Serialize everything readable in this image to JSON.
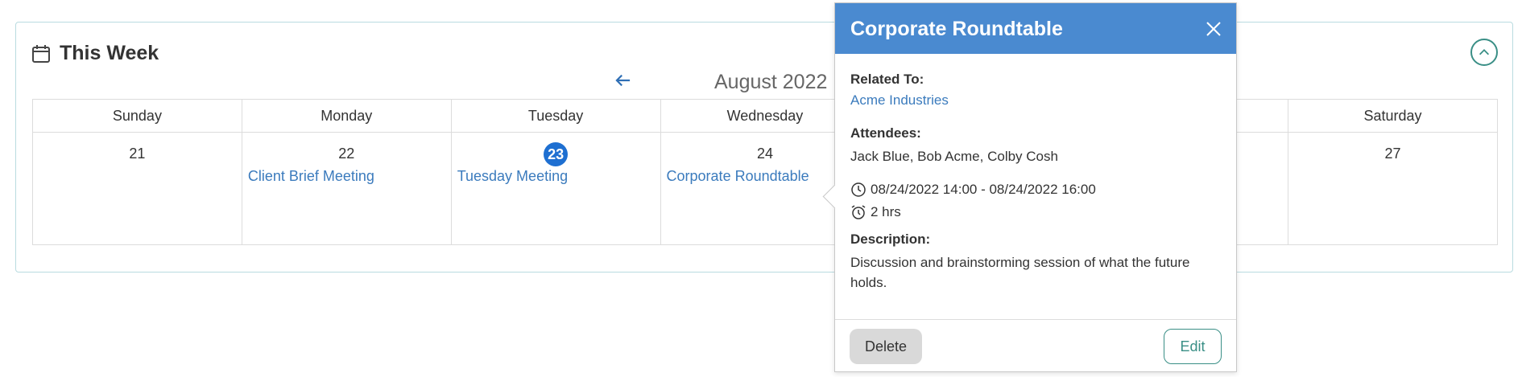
{
  "widget": {
    "title": "This Week",
    "icons": {
      "header": "calendar-icon",
      "collapse": "chevron-up-icon",
      "prev": "arrow-left-icon"
    }
  },
  "calendar": {
    "month_label": "August 2022",
    "days": [
      {
        "name": "Sunday",
        "date": "21",
        "events": []
      },
      {
        "name": "Monday",
        "date": "22",
        "events": [
          "Client Brief Meeting"
        ]
      },
      {
        "name": "Tuesday",
        "date": "23",
        "events": [
          "Tuesday Meeting"
        ],
        "today": true
      },
      {
        "name": "Wednesday",
        "date": "24",
        "events": [
          "Corporate Roundtable"
        ]
      },
      {
        "name": "",
        "date": "",
        "events": []
      },
      {
        "name": "",
        "date": "",
        "events": []
      },
      {
        "name": "Saturday",
        "date": "27",
        "events": []
      }
    ],
    "colors": {
      "today": "#1e6fd1",
      "event_link": "#3b7bbd"
    }
  },
  "popover": {
    "title": "Corporate Roundtable",
    "header_color": "#4a8ad0",
    "related_label": "Related To:",
    "related_value": "Acme Industries",
    "attendees_label": "Attendees:",
    "attendees_value": "Jack Blue, Bob Acme, Colby Cosh",
    "time_range": "08/24/2022 14:00 - 08/24/2022 16:00",
    "duration": "2 hrs",
    "description_label": "Description:",
    "description_value": "Discussion and brainstorming session of what the future holds.",
    "delete_label": "Delete",
    "edit_label": "Edit",
    "icons": {
      "close": "close-icon",
      "time": "clock-icon",
      "duration": "alarm-clock-icon"
    }
  }
}
